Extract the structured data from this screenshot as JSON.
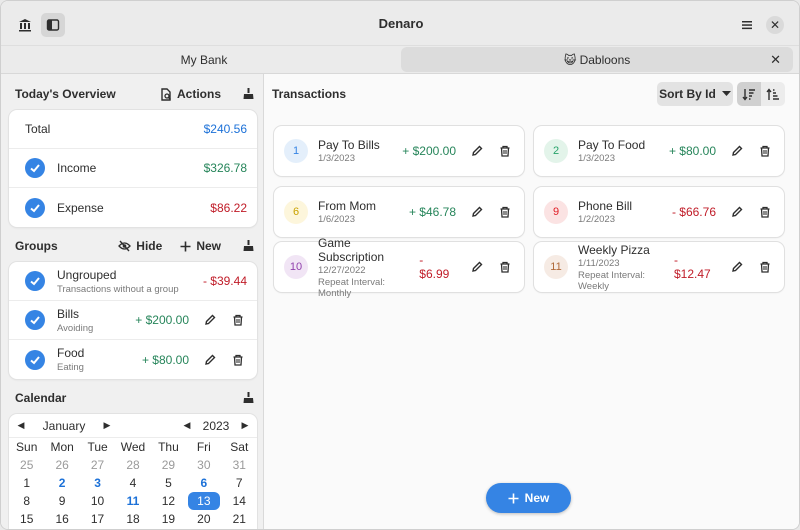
{
  "window": {
    "title": "Denaro"
  },
  "tabs": [
    {
      "label": "My Bank"
    },
    {
      "label": "😺 Dabloons"
    }
  ],
  "overview": {
    "title": "Today's Overview",
    "actions_label": "Actions",
    "total_label": "Total",
    "total_value": "$240.56",
    "income_label": "Income",
    "income_value": "$326.78",
    "expense_label": "Expense",
    "expense_value": "$86.22"
  },
  "groups": {
    "title": "Groups",
    "hide_label": "Hide",
    "new_label": "New",
    "items": [
      {
        "name": "Ungrouped",
        "desc": "Transactions without a group",
        "amount": "- $39.44"
      },
      {
        "name": "Bills",
        "desc": "Avoiding",
        "amount": "+ $200.00"
      },
      {
        "name": "Food",
        "desc": "Eating",
        "amount": "+ $80.00"
      }
    ]
  },
  "calendar": {
    "title": "Calendar",
    "month": "January",
    "year": "2023",
    "weekdays": [
      "Sun",
      "Mon",
      "Tue",
      "Wed",
      "Thu",
      "Fri",
      "Sat"
    ],
    "row1": [
      "25",
      "26",
      "27",
      "28",
      "29",
      "30",
      "31"
    ],
    "row2": [
      "1",
      "2",
      "3",
      "4",
      "5",
      "6",
      "7"
    ],
    "row3": [
      "8",
      "9",
      "10",
      "11",
      "12",
      "13",
      "14"
    ],
    "row4": [
      "15",
      "16",
      "17",
      "18",
      "19",
      "20",
      "21"
    ]
  },
  "transactions": {
    "title": "Transactions",
    "sort_label": "Sort By Id",
    "new_label": "New",
    "items": [
      {
        "id": "1",
        "name": "Pay To Bills",
        "date": "1/3/2023",
        "repeat": "",
        "amount": "+ $200.00",
        "color": "#3584e4",
        "bg": "#e4effb"
      },
      {
        "id": "2",
        "name": "Pay To Food",
        "date": "1/3/2023",
        "repeat": "",
        "amount": "+ $80.00",
        "color": "#26a269",
        "bg": "#e3f4ea"
      },
      {
        "id": "6",
        "name": "From Mom",
        "date": "1/6/2023",
        "repeat": "",
        "amount": "+ $46.78",
        "color": "#c9a200",
        "bg": "#fdf6dc"
      },
      {
        "id": "9",
        "name": "Phone Bill",
        "date": "1/2/2023",
        "repeat": "",
        "amount": "- $66.76",
        "color": "#e01b24",
        "bg": "#fbe3e3"
      },
      {
        "id": "10",
        "name": "Game Subscription",
        "date": "12/27/2022",
        "repeat": "Repeat Interval: Monthly",
        "amount": "- $6.99",
        "color": "#9141ac",
        "bg": "#f1e5f5"
      },
      {
        "id": "11",
        "name": "Weekly Pizza",
        "date": "1/11/2023",
        "repeat": "Repeat Interval: Weekly",
        "amount": "- $12.47",
        "color": "#b06a3a",
        "bg": "#f6ebe4"
      }
    ]
  }
}
